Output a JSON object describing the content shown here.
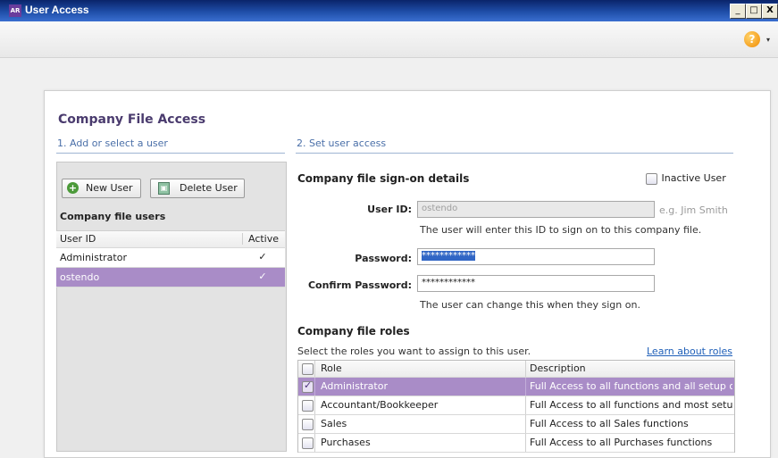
{
  "window": {
    "title": "User Access",
    "app_icon_text": "AR",
    "minimize": "_",
    "maximize": "□",
    "close": "X"
  },
  "toolbar": {
    "help_icon_text": "?",
    "help_caret": "▾"
  },
  "page": {
    "title": "Company File Access",
    "step1": "1. Add or select a user",
    "step2": "2. Set user access"
  },
  "left": {
    "new_user_label": "New User",
    "delete_user_label": "Delete User",
    "users_heading": "Company file users",
    "columns": {
      "user_id": "User ID",
      "active": "Active"
    },
    "users": [
      {
        "id": "Administrator",
        "active": "✓"
      },
      {
        "id": "ostendo",
        "active": "✓"
      }
    ]
  },
  "signon": {
    "heading": "Company file sign-on details",
    "inactive_label": "Inactive User",
    "user_id_label": "User ID:",
    "user_id_value": "ostendo",
    "user_id_example": "e.g. Jim Smith",
    "user_id_hint": "The user will enter this ID to sign on to this company file.",
    "password_label": "Password:",
    "password_value": "************",
    "confirm_label": "Confirm Password:",
    "confirm_value": "************",
    "password_hint": "The user can change this when they sign on."
  },
  "roles": {
    "heading": "Company file roles",
    "instruction": "Select the roles you want to assign to this user.",
    "learn_link": "Learn about roles",
    "columns": {
      "role": "Role",
      "description": "Description"
    },
    "items": [
      {
        "name": "Administrator",
        "description": "Full Access to all functions and all setup optio",
        "checked": true
      },
      {
        "name": "Accountant/Bookkeeper",
        "description": "Full Access to all functions and most setup op",
        "checked": false
      },
      {
        "name": "Sales",
        "description": "Full Access to all Sales functions",
        "checked": false
      },
      {
        "name": "Purchases",
        "description": "Full Access to all Purchases functions",
        "checked": false
      }
    ]
  },
  "colors": {
    "accent": "#a98cc7",
    "title": "#4a3b6e",
    "link": "#1f5fb8",
    "step": "#4a6fa8"
  }
}
